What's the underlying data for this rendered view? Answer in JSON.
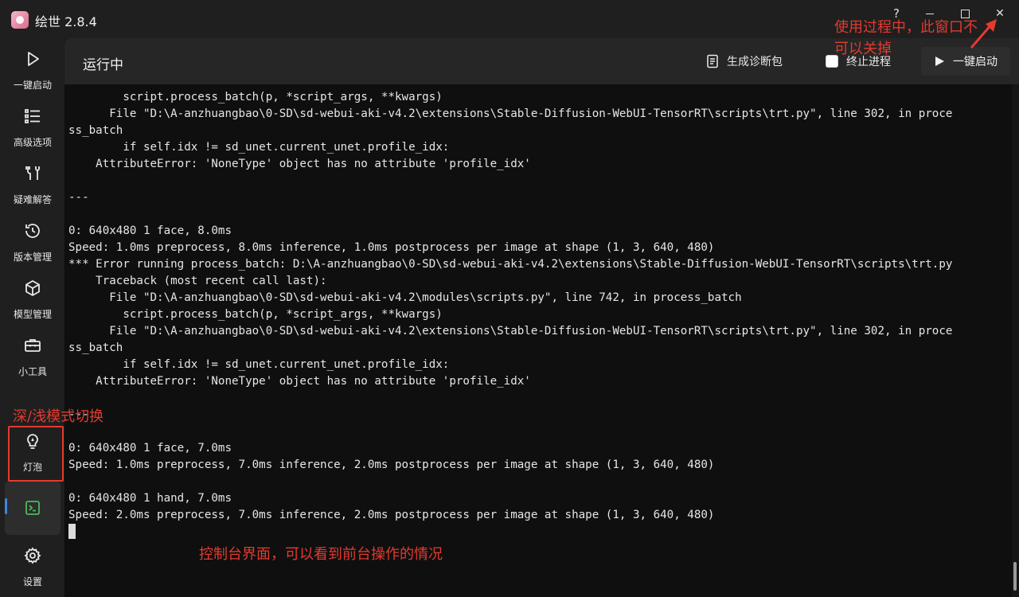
{
  "window": {
    "title": "绘世 2.8.4",
    "help_glyph": "?",
    "close_glyph": "✕"
  },
  "sidebar": {
    "items": [
      {
        "label": "一键启动",
        "icon": "play-icon"
      },
      {
        "label": "高级选项",
        "icon": "list-settings-icon"
      },
      {
        "label": "疑难解答",
        "icon": "tools-icon"
      },
      {
        "label": "版本管理",
        "icon": "history-icon"
      },
      {
        "label": "模型管理",
        "icon": "cube-icon"
      },
      {
        "label": "小工具",
        "icon": "toolbox-icon"
      },
      {
        "label": "灯泡",
        "icon": "lightbulb-icon"
      },
      {
        "label": "",
        "icon": "terminal-icon",
        "active": true
      },
      {
        "label": "设置",
        "icon": "gear-icon"
      }
    ]
  },
  "header": {
    "title": "运行中",
    "diag_label": "生成诊断包",
    "stop_label": "终止进程",
    "launch_label": "一键启动"
  },
  "console": {
    "lines": [
      "        script.process_batch(p, *script_args, **kwargs)",
      "      File \"D:\\A-anzhuangbao\\0-SD\\sd-webui-aki-v4.2\\extensions\\Stable-Diffusion-WebUI-TensorRT\\scripts\\trt.py\", line 302, in proce",
      "ss_batch",
      "        if self.idx != sd_unet.current_unet.profile_idx:",
      "    AttributeError: 'NoneType' object has no attribute 'profile_idx'",
      "",
      "---",
      "",
      "0: 640x480 1 face, 8.0ms",
      "Speed: 1.0ms preprocess, 8.0ms inference, 1.0ms postprocess per image at shape (1, 3, 640, 480)",
      "*** Error running process_batch: D:\\A-anzhuangbao\\0-SD\\sd-webui-aki-v4.2\\extensions\\Stable-Diffusion-WebUI-TensorRT\\scripts\\trt.py",
      "    Traceback (most recent call last):",
      "      File \"D:\\A-anzhuangbao\\0-SD\\sd-webui-aki-v4.2\\modules\\scripts.py\", line 742, in process_batch",
      "        script.process_batch(p, *script_args, **kwargs)",
      "      File \"D:\\A-anzhuangbao\\0-SD\\sd-webui-aki-v4.2\\extensions\\Stable-Diffusion-WebUI-TensorRT\\scripts\\trt.py\", line 302, in proce",
      "ss_batch",
      "        if self.idx != sd_unet.current_unet.profile_idx:",
      "    AttributeError: 'NoneType' object has no attribute 'profile_idx'",
      "",
      "---",
      "",
      "0: 640x480 1 face, 7.0ms",
      "Speed: 1.0ms preprocess, 7.0ms inference, 2.0ms postprocess per image at shape (1, 3, 640, 480)",
      "",
      "0: 640x480 1 hand, 7.0ms",
      "Speed: 2.0ms preprocess, 7.0ms inference, 2.0ms postprocess per image at shape (1, 3, 640, 480)"
    ]
  },
  "annotations": {
    "window_note": "使用过程中，此窗口不可以关掉",
    "theme_note": "深/浅模式切换",
    "console_note": "控制台界面，可以看到前台操作的情况"
  },
  "colors": {
    "annotation": "#e53a2f",
    "accent": "#3b88e0",
    "terminal_icon": "#4cbb5c"
  }
}
